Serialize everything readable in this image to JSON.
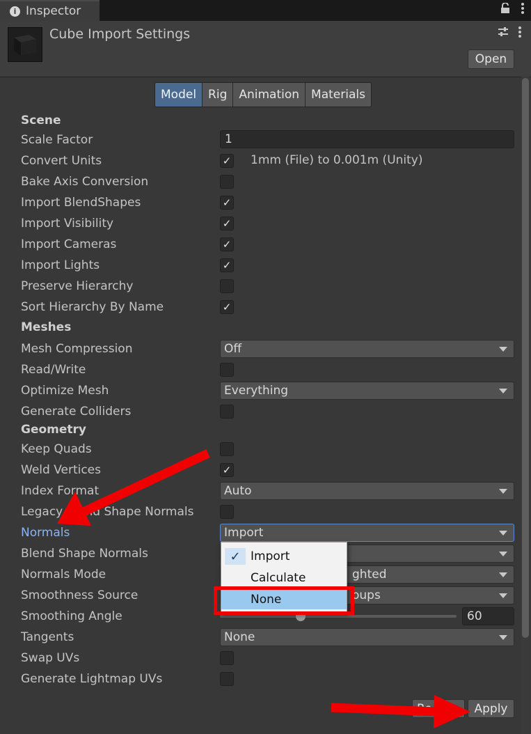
{
  "window": {
    "tab_title": "Inspector",
    "tab_icons": [
      "lock-icon",
      "kebab-menu-icon"
    ]
  },
  "header": {
    "title": "Cube Import Settings",
    "open_label": "Open"
  },
  "tabs": [
    "Model",
    "Rig",
    "Animation",
    "Materials"
  ],
  "active_tab": "Model",
  "sections": {
    "scene": "Scene",
    "meshes": "Meshes",
    "geometry": "Geometry"
  },
  "labels": {
    "scale_factor": "Scale Factor",
    "convert_units": "Convert Units",
    "bake_axis": "Bake Axis Conversion",
    "import_blendshapes": "Import BlendShapes",
    "import_visibility": "Import Visibility",
    "import_cameras": "Import Cameras",
    "import_lights": "Import Lights",
    "preserve_hierarchy": "Preserve Hierarchy",
    "sort_hierarchy": "Sort Hierarchy By Name",
    "mesh_compression": "Mesh Compression",
    "read_write": "Read/Write",
    "optimize_mesh": "Optimize Mesh",
    "generate_colliders": "Generate Colliders",
    "keep_quads": "Keep Quads",
    "weld_vertices": "Weld Vertices",
    "index_format": "Index Format",
    "legacy_blend": "Legacy Blend Shape Normals",
    "normals": "Normals",
    "blend_shape_normals": "Blend Shape Normals",
    "normals_mode": "Normals Mode",
    "smoothness_source": "Smoothness Source",
    "smoothing_angle": "Smoothing Angle",
    "tangents": "Tangents",
    "swap_uvs": "Swap UVs",
    "generate_lightmap_uvs": "Generate Lightmap UVs"
  },
  "values": {
    "scale_factor": "1",
    "convert_units_note": "1mm (File) to 0.001m (Unity)",
    "mesh_compression": "Off",
    "optimize_mesh": "Everything",
    "index_format": "Auto",
    "normals": "Import",
    "normals_mode_partial": "ghted",
    "smoothness_source_partial": "oups",
    "smoothing_angle": "60",
    "tangents": "None"
  },
  "checkboxes": {
    "convert_units": true,
    "bake_axis": false,
    "import_blendshapes": true,
    "import_visibility": true,
    "import_cameras": true,
    "import_lights": true,
    "preserve_hierarchy": false,
    "sort_hierarchy": true,
    "read_write": false,
    "generate_colliders": false,
    "keep_quads": false,
    "weld_vertices": true,
    "legacy_blend": false,
    "swap_uvs": false,
    "generate_lightmap_uvs": false
  },
  "check_mark": "✓",
  "normals_popup": {
    "options": [
      "Import",
      "Calculate",
      "None"
    ],
    "selected": "Import",
    "highlighted": "None"
  },
  "footer": {
    "revert_label_partial": "Re",
    "apply_label": "Apply"
  },
  "colors": {
    "background": "#383838",
    "active_tab": "#4b6a8f",
    "normals_label": "#8cb4f2",
    "annotation_red": "#f00000",
    "popup_highlight": "#99c9ef"
  }
}
